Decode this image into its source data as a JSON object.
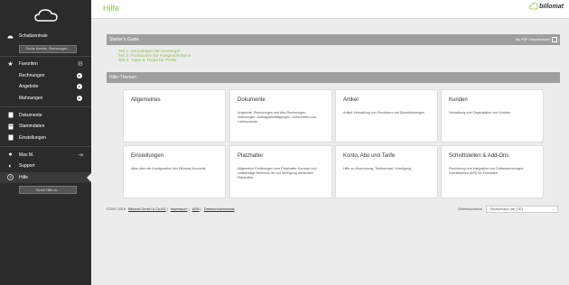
{
  "sidebar": {
    "dashboard_label": "Schaltzentrale",
    "search_customers": "Suche Kunden, Rechnungen...",
    "favorites_label": "Favoriten",
    "fav_items": [
      "Rechnungen",
      "Angebote",
      "Mahnungen"
    ],
    "documents_label": "Dokumente",
    "master_data_label": "Stammdaten",
    "settings_label": "Einstellungen",
    "user_label": "Max M.",
    "support_label": "Support",
    "help_label": "Hilfe",
    "search_help": "Suche Hilfe zu..."
  },
  "header": {
    "title": "Hilfe",
    "brand": "billomat"
  },
  "main": {
    "starters_guide_label": "Starter's Guide",
    "pdf_download_label": "Als PDF herunterladen",
    "guide_links": [
      "Teil 1: Grundlagen für Einsteiger",
      "Teil 2: Funktionen für Fortgeschrittene",
      "Teil 3: Tipps & Tricks für Profis"
    ],
    "help_topics_label": "Hilfe-Themen",
    "cards": [
      {
        "title": "Allgemeines",
        "desc": ""
      },
      {
        "title": "Dokumente",
        "desc": "Angebote, Rechnungen und Abo-Rechnungen, Mahnungen, Auftragsbestätigungen, Gutschriften und Lieferscheine."
      },
      {
        "title": "Artikel",
        "desc": "Artikel-Verwaltung von Produkten und Dienstleistungen."
      },
      {
        "title": "Kunden",
        "desc": "Verwaltung und Organisation von Kunden"
      },
      {
        "title": "Einstellungen",
        "desc": "Alles über die Konfiguration des Billomat-Accounts"
      },
      {
        "title": "Platzhalter",
        "desc": "Allgemeine Erklärungen zum Platzhalter-Konzept und vollständige Referenz der zur Verfügung stehenden Platzhalter."
      },
      {
        "title": "Konto, Abo und Tarife",
        "desc": "Hilfe zu Abrechnung, Tarifwechsel, Kündigung"
      },
      {
        "title": "Schnittstellen & Add-Ons",
        "desc": "Einrichtung und Integration von Drittanwendungen, Schnittstellen (API) für Entwickler."
      }
    ],
    "footer": {
      "copyright": "©2007-2018",
      "company_link": "Billomat GmbH & Co.KG",
      "imprint_link": "Impressum",
      "terms_link": "AGB",
      "privacy_link": "Datenschutzhinweis",
      "sep1": "|",
      "sep2": "|",
      "sep3": "|"
    },
    "billing_label": "Gebietsschema:",
    "billing_value": "Deutschland (de_DE)"
  },
  "colors": {
    "accent": "#8bc34a",
    "sidebar_bg": "#2b2b2b",
    "bar_gray": "#9e9e9e"
  }
}
